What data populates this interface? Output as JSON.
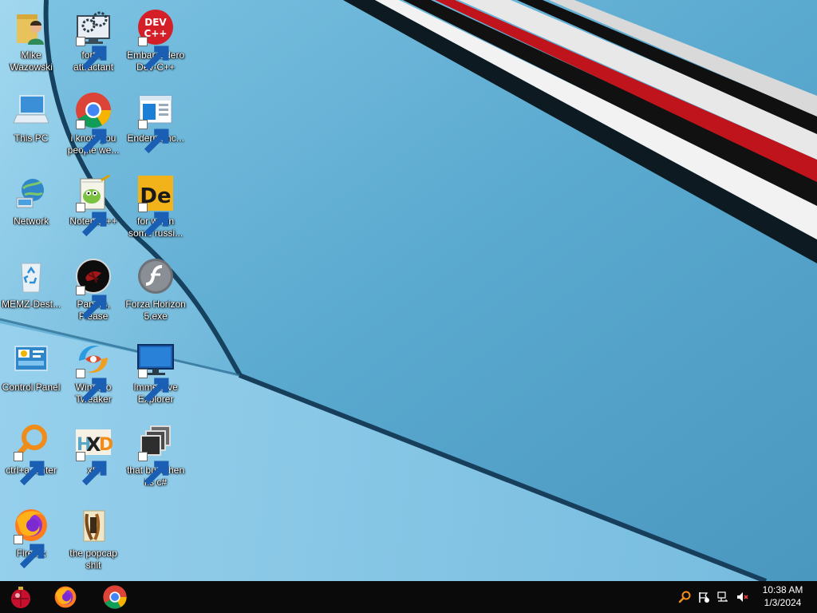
{
  "desktop": {
    "icons": [
      {
        "label": "Mike Wazowski"
      },
      {
        "label": "forkie attractant"
      },
      {
        "label": "Embarcadero Dev-C++"
      },
      {
        "label": "This PC"
      },
      {
        "label": "i know you people we..."
      },
      {
        "label": "Endermanc..."
      },
      {
        "label": "Network"
      },
      {
        "label": "Notepad++"
      },
      {
        "label": "for when some russi..."
      },
      {
        "label": "MEMZ-Dest..."
      },
      {
        "label": "Papers, Please"
      },
      {
        "label": "Forza Horizon 5.exe"
      },
      {
        "label": "Control Panel"
      },
      {
        "label": "Winaero Tweaker"
      },
      {
        "label": "Immersive Explorer"
      },
      {
        "label": "ctrl+a, enter"
      },
      {
        "label": "xD"
      },
      {
        "label": "that but when its c#"
      },
      {
        "label": "Firefox"
      },
      {
        "label": "the popcap shit"
      }
    ],
    "dev_cpp_badge": {
      "line1": "DEV",
      "line2": "C++"
    },
    "dev_explorer_badge": "De",
    "hxd_badge": {
      "h": "H",
      "x": "X",
      "d": "D"
    }
  },
  "taskbar": {
    "pinned": [
      {
        "icon": "start-ornament-icon"
      },
      {
        "icon": "firefox-icon"
      },
      {
        "icon": "chrome-icon"
      }
    ],
    "tray": [
      {
        "icon": "search-tray-icon"
      },
      {
        "icon": "action-center-flag-icon"
      },
      {
        "icon": "network-icon"
      },
      {
        "icon": "volume-muted-icon"
      }
    ],
    "clock": {
      "time": "10:38 AM",
      "date": "1/3/2024"
    }
  },
  "colors": {
    "wallpaper_blue": "#5aa9cf",
    "taskbar": "#0a0a0a",
    "stripe_red": "#c0141c"
  }
}
